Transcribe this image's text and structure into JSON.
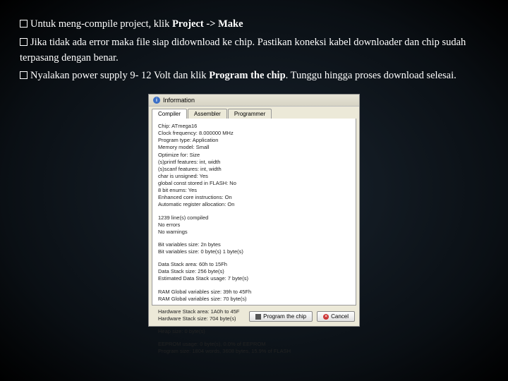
{
  "bullets": {
    "b1a": "Untuk meng-compile project, klik ",
    "b1b": "Project -> Make",
    "b2": "Jika tidak ada error maka file siap didownload ke chip. Pastikan koneksi kabel downloader dan chip sudah terpasang dengan benar.",
    "b3a": "Nyalakan power supply 9- 12 Volt dan klik ",
    "b3b": "Program the chip",
    "b3c": ". Tunggu hingga proses download selesai."
  },
  "dialog": {
    "title": "Information",
    "tabs": {
      "t1": "Compiler",
      "t2": "Assembler",
      "t3": "Programmer"
    },
    "block1": "Chip: ATmega16\nClock frequency: 8.000000 MHz\nProgram type: Application\nMemory model: Small\nOptimize for: Size\n(s)printf features: int, width\n(s)scanf features: int, width\nchar is unsigned: Yes\nglobal const stored in FLASH: No\n8 bit enums: Yes\nEnhanced core instructions: On\nAutomatic register allocation: On",
    "block2": "1239 line(s) compiled\nNo errors\nNo warnings",
    "block3": "Bit variables size: 2n bytes\nBit variables size: 0 byte(s)  1 byte(s)",
    "block4": "Data Stack area: 60h to 15Fh\nData Stack size: 256 byte(s)\nEstimated Data Stack usage: 7 byte(s)",
    "block5": "RAM Global variables size: 39h to 45Fh\nRAM Global variables size: 70 byte(s)",
    "block6": "Hardware Stack area: 1A0h to 45F\nHardware Stack size: 704 byte(s)",
    "block7": "Heap size: 0 byte(s)",
    "block8": "EEPROM usage: 0 byte(s), 0.0% of EEPROM\nProgram size: 1804 words, 3608 bytes, 15.9% of FLASH",
    "buttons": {
      "program": "Program the chip",
      "cancel": "Cancel"
    }
  }
}
